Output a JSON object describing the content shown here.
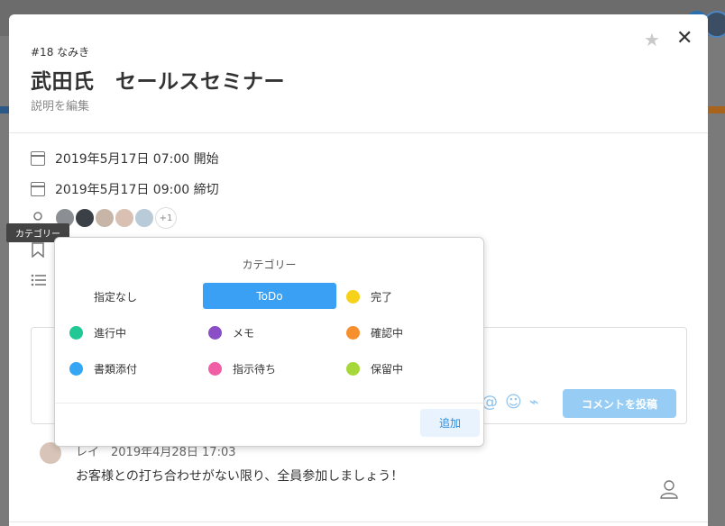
{
  "task": {
    "id_label": "#18 なみき",
    "title": "武田氏　セールスセミナー",
    "edit_description": "説明を編集"
  },
  "dates": {
    "start": "2019年5月17日 07:00 開始",
    "due": "2019年5月17日 09:00 締切"
  },
  "assignees": {
    "avatars": [
      "avatar-1",
      "avatar-2",
      "avatar-3",
      "avatar-4",
      "avatar-5"
    ],
    "more": "+1"
  },
  "tooltip": "カテゴリー",
  "category_popup": {
    "title": "カテゴリー",
    "add_label": "追加",
    "options": [
      {
        "label": "指定なし",
        "color": null
      },
      {
        "label": "ToDo",
        "color": "#3aa0f3",
        "selected": true
      },
      {
        "label": "完了",
        "color": "#f7d21a"
      },
      {
        "label": "進行中",
        "color": "#22c796"
      },
      {
        "label": "メモ",
        "color": "#8a4fc7"
      },
      {
        "label": "確認中",
        "color": "#f78f2e"
      },
      {
        "label": "書類添付",
        "color": "#35a6f4"
      },
      {
        "label": "指示待ち",
        "color": "#f05fa6"
      },
      {
        "label": "保留中",
        "color": "#a6d83a"
      }
    ]
  },
  "comment_form": {
    "post_label": "コメントを投稿",
    "tools": [
      "@",
      "☺",
      "⌁"
    ]
  },
  "comment": {
    "meta": "レイ　2019年4月28日 17:03",
    "body": "お客様との打ち合わせがない限り、全員参加しましょう！"
  },
  "colors": {
    "accent": "#3aa0f3",
    "post_button": "#97ccf4"
  }
}
